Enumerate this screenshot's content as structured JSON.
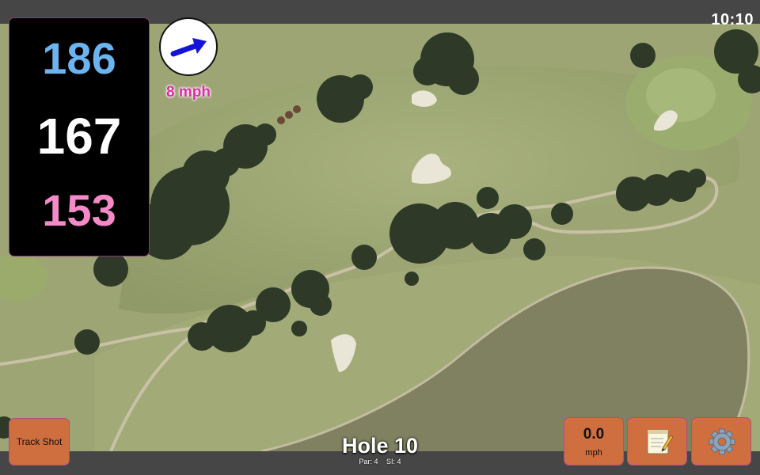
{
  "clock": "10:10",
  "distances": {
    "back": "186",
    "center": "167",
    "front": "153"
  },
  "wind": {
    "speed": "8 mph",
    "direction_icon": "arrow-right-icon"
  },
  "buttons": {
    "track_shot": "Track Shot",
    "speed_value": "0.0",
    "speed_unit": "mph",
    "notes_icon": "notepad-icon",
    "settings_icon": "gear-icon"
  },
  "hole": {
    "title": "Hole 10",
    "par": "Par: 4",
    "si": "SI: 4"
  },
  "colors": {
    "back_distance": "#6cb4f0",
    "center_distance": "#ffffff",
    "front_distance": "#f48ac8",
    "wind_text": "#e02aa8",
    "button_bg": "#cf6e3f",
    "panel_border": "#8a3a7a"
  }
}
